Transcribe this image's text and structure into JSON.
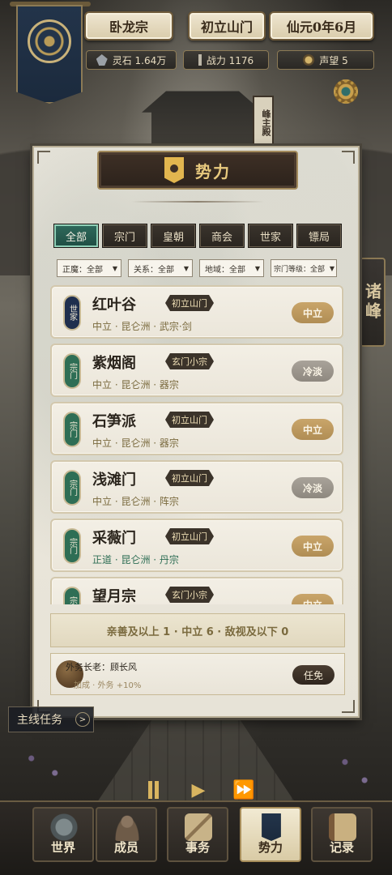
{
  "header": {
    "sect_name": "卧龙宗",
    "sect_rank": "初立山门",
    "date": "仙元0年6月",
    "stats": {
      "spirit_stones": "灵石 1.64万",
      "power": "战力 1176",
      "reputation": "声望 5"
    }
  },
  "background": {
    "hall_sign": "峰主殿"
  },
  "side_tab": {
    "label": "诸峰"
  },
  "panel": {
    "title": "势力",
    "tabs": [
      {
        "label": "全部",
        "active": true
      },
      {
        "label": "宗门",
        "active": false
      },
      {
        "label": "皇朝",
        "active": false
      },
      {
        "label": "商会",
        "active": false
      },
      {
        "label": "世家",
        "active": false
      },
      {
        "label": "镖局",
        "active": false
      }
    ],
    "filters": [
      {
        "label": "正魔：全部"
      },
      {
        "label": "关系：全部"
      },
      {
        "label": "地域：全部"
      },
      {
        "label": "宗门等级：全部"
      }
    ],
    "factions": [
      {
        "type": "世家",
        "name": "红叶谷",
        "tag": "初立山门",
        "sub": "中立 · 昆仑洲 · 武宗·剑",
        "relation": "中立",
        "relation_kind": "neutral"
      },
      {
        "type": "宗门",
        "name": "紫烟阁",
        "tag": "玄门小宗",
        "sub": "中立 · 昆仑洲 · 器宗",
        "relation": "冷淡",
        "relation_kind": "cold"
      },
      {
        "type": "宗门",
        "name": "石笋派",
        "tag": "初立山门",
        "sub": "中立 · 昆仑洲 · 器宗",
        "relation": "中立",
        "relation_kind": "neutral"
      },
      {
        "type": "宗门",
        "name": "浅滩门",
        "tag": "初立山门",
        "sub": "中立 · 昆仑洲 · 阵宗",
        "relation": "冷淡",
        "relation_kind": "cold"
      },
      {
        "type": "宗门",
        "name": "采薇门",
        "tag": "初立山门",
        "sub": "正道 · 昆仑洲 · 丹宗",
        "relation": "中立",
        "relation_kind": "neutral"
      },
      {
        "type": "宗门",
        "name": "望月宗",
        "tag": "玄门小宗",
        "sub": "",
        "relation": "中立",
        "relation_kind": "neutral"
      }
    ],
    "summary": "亲善及以上 1 · 中立 6 · 敌视及以下 0",
    "elder": {
      "title": "外务长老：顾长风",
      "sub": "加成 · 外务 +10%",
      "button": "任免"
    }
  },
  "quest": {
    "label": "主线任务",
    "arrow": ">"
  },
  "speed_controls": [
    "pause",
    "play",
    "fast-forward"
  ],
  "bottom_nav": [
    {
      "label": "世界",
      "active": false
    },
    {
      "label": "成员",
      "active": false
    },
    {
      "label": "事务",
      "active": false
    },
    {
      "label": "势力",
      "active": true
    },
    {
      "label": "记录",
      "active": false
    }
  ],
  "colors": {
    "accent_teal": "#2f6a5c",
    "badge_green": "#2e6e55",
    "badge_navy": "#1f2f4e",
    "neutral_gold": "#c9a56a",
    "cold_gray": "#a9a39a",
    "title_gold": "#e7c97e"
  }
}
